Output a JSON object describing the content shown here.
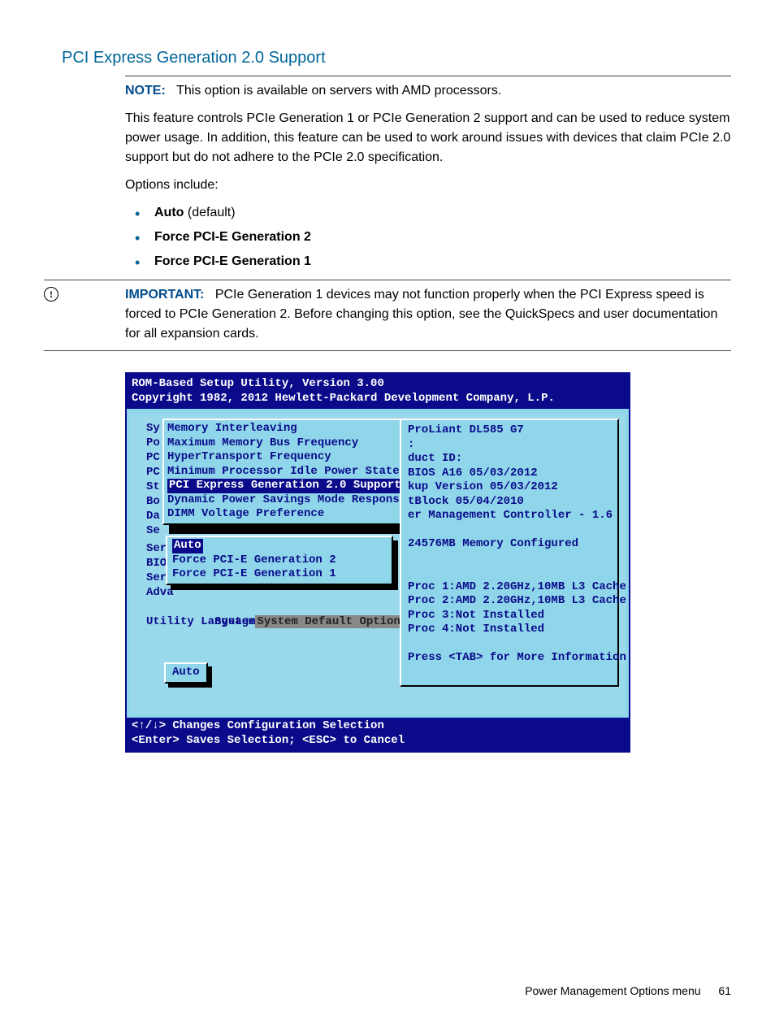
{
  "section_title": "PCI Express Generation 2.0 Support",
  "note_label": "NOTE:",
  "note_text": "This option is available on servers with AMD processors.",
  "desc": "This feature controls PCIe Generation 1 or PCIe Generation 2 support and can be used to reduce system power usage. In addition, this feature can be used to work around issues with devices that claim PCIe 2.0 support but do not adhere to the PCIe 2.0 specification.",
  "options_intro": "Options include:",
  "options": [
    {
      "bold": "Auto",
      "extra": " (default)"
    },
    {
      "bold": "Force PCI-E Generation 2",
      "extra": ""
    },
    {
      "bold": "Force PCI-E Generation 1",
      "extra": ""
    }
  ],
  "important_label": "IMPORTANT:",
  "important_icon": "!",
  "important_text": "PCIe Generation 1 devices may not function properly when the PCI Express speed is forced to PCIe Generation 2. Before changing this option, see the QuickSpecs and user documentation for all expansion cards.",
  "bios": {
    "header_line1": "ROM-Based Setup Utility, Version 3.00",
    "header_line2": "Copyright 1982, 2012 Hewlett-Packard Development Company, L.P.",
    "left_labels": [
      "Sy",
      "Po",
      "PC",
      "PC",
      "St",
      "Bo",
      "Da",
      "Se",
      "Serv",
      "BIOS",
      "Serv",
      "Adva"
    ],
    "menu": [
      "Memory Interleaving",
      "Maximum Memory Bus Frequency",
      "HyperTransport Frequency",
      "Minimum Processor Idle Power State",
      "PCI Express Generation 2.0 Support",
      "Dynamic Power Savings Mode Response",
      "DIMM Voltage Preference"
    ],
    "menu_selected_index": 4,
    "below_menu": {
      "system_default": "System Default Options",
      "utility_lang": "Utility Language"
    },
    "popup": [
      "Auto",
      "Force PCI-E Generation 2",
      "Force PCI-E Generation 1"
    ],
    "popup_selected_index": 0,
    "status_value": "Auto",
    "right": {
      "model": "ProLiant DL585 G7",
      "l2": ":",
      "l3": "duct ID:",
      "l4": "BIOS A16 05/03/2012",
      "l5": "kup Version 05/03/2012",
      "l6": "tBlock 05/04/2010",
      "l7": "er Management Controller - 1.6",
      "mem": "24576MB Memory Configured",
      "p1": "Proc 1:AMD 2.20GHz,10MB L3 Cache",
      "p2": "Proc 2:AMD 2.20GHz,10MB L3 Cache",
      "p3": "Proc 3:Not Installed",
      "p4": "Proc 4:Not Installed",
      "tab": "Press <TAB> for More Information"
    },
    "footer_line1": "<↑/↓> Changes Configuration Selection",
    "footer_line2": "<Enter> Saves Selection; <ESC> to Cancel"
  },
  "footer": {
    "section": "Power Management Options menu",
    "page": "61"
  }
}
